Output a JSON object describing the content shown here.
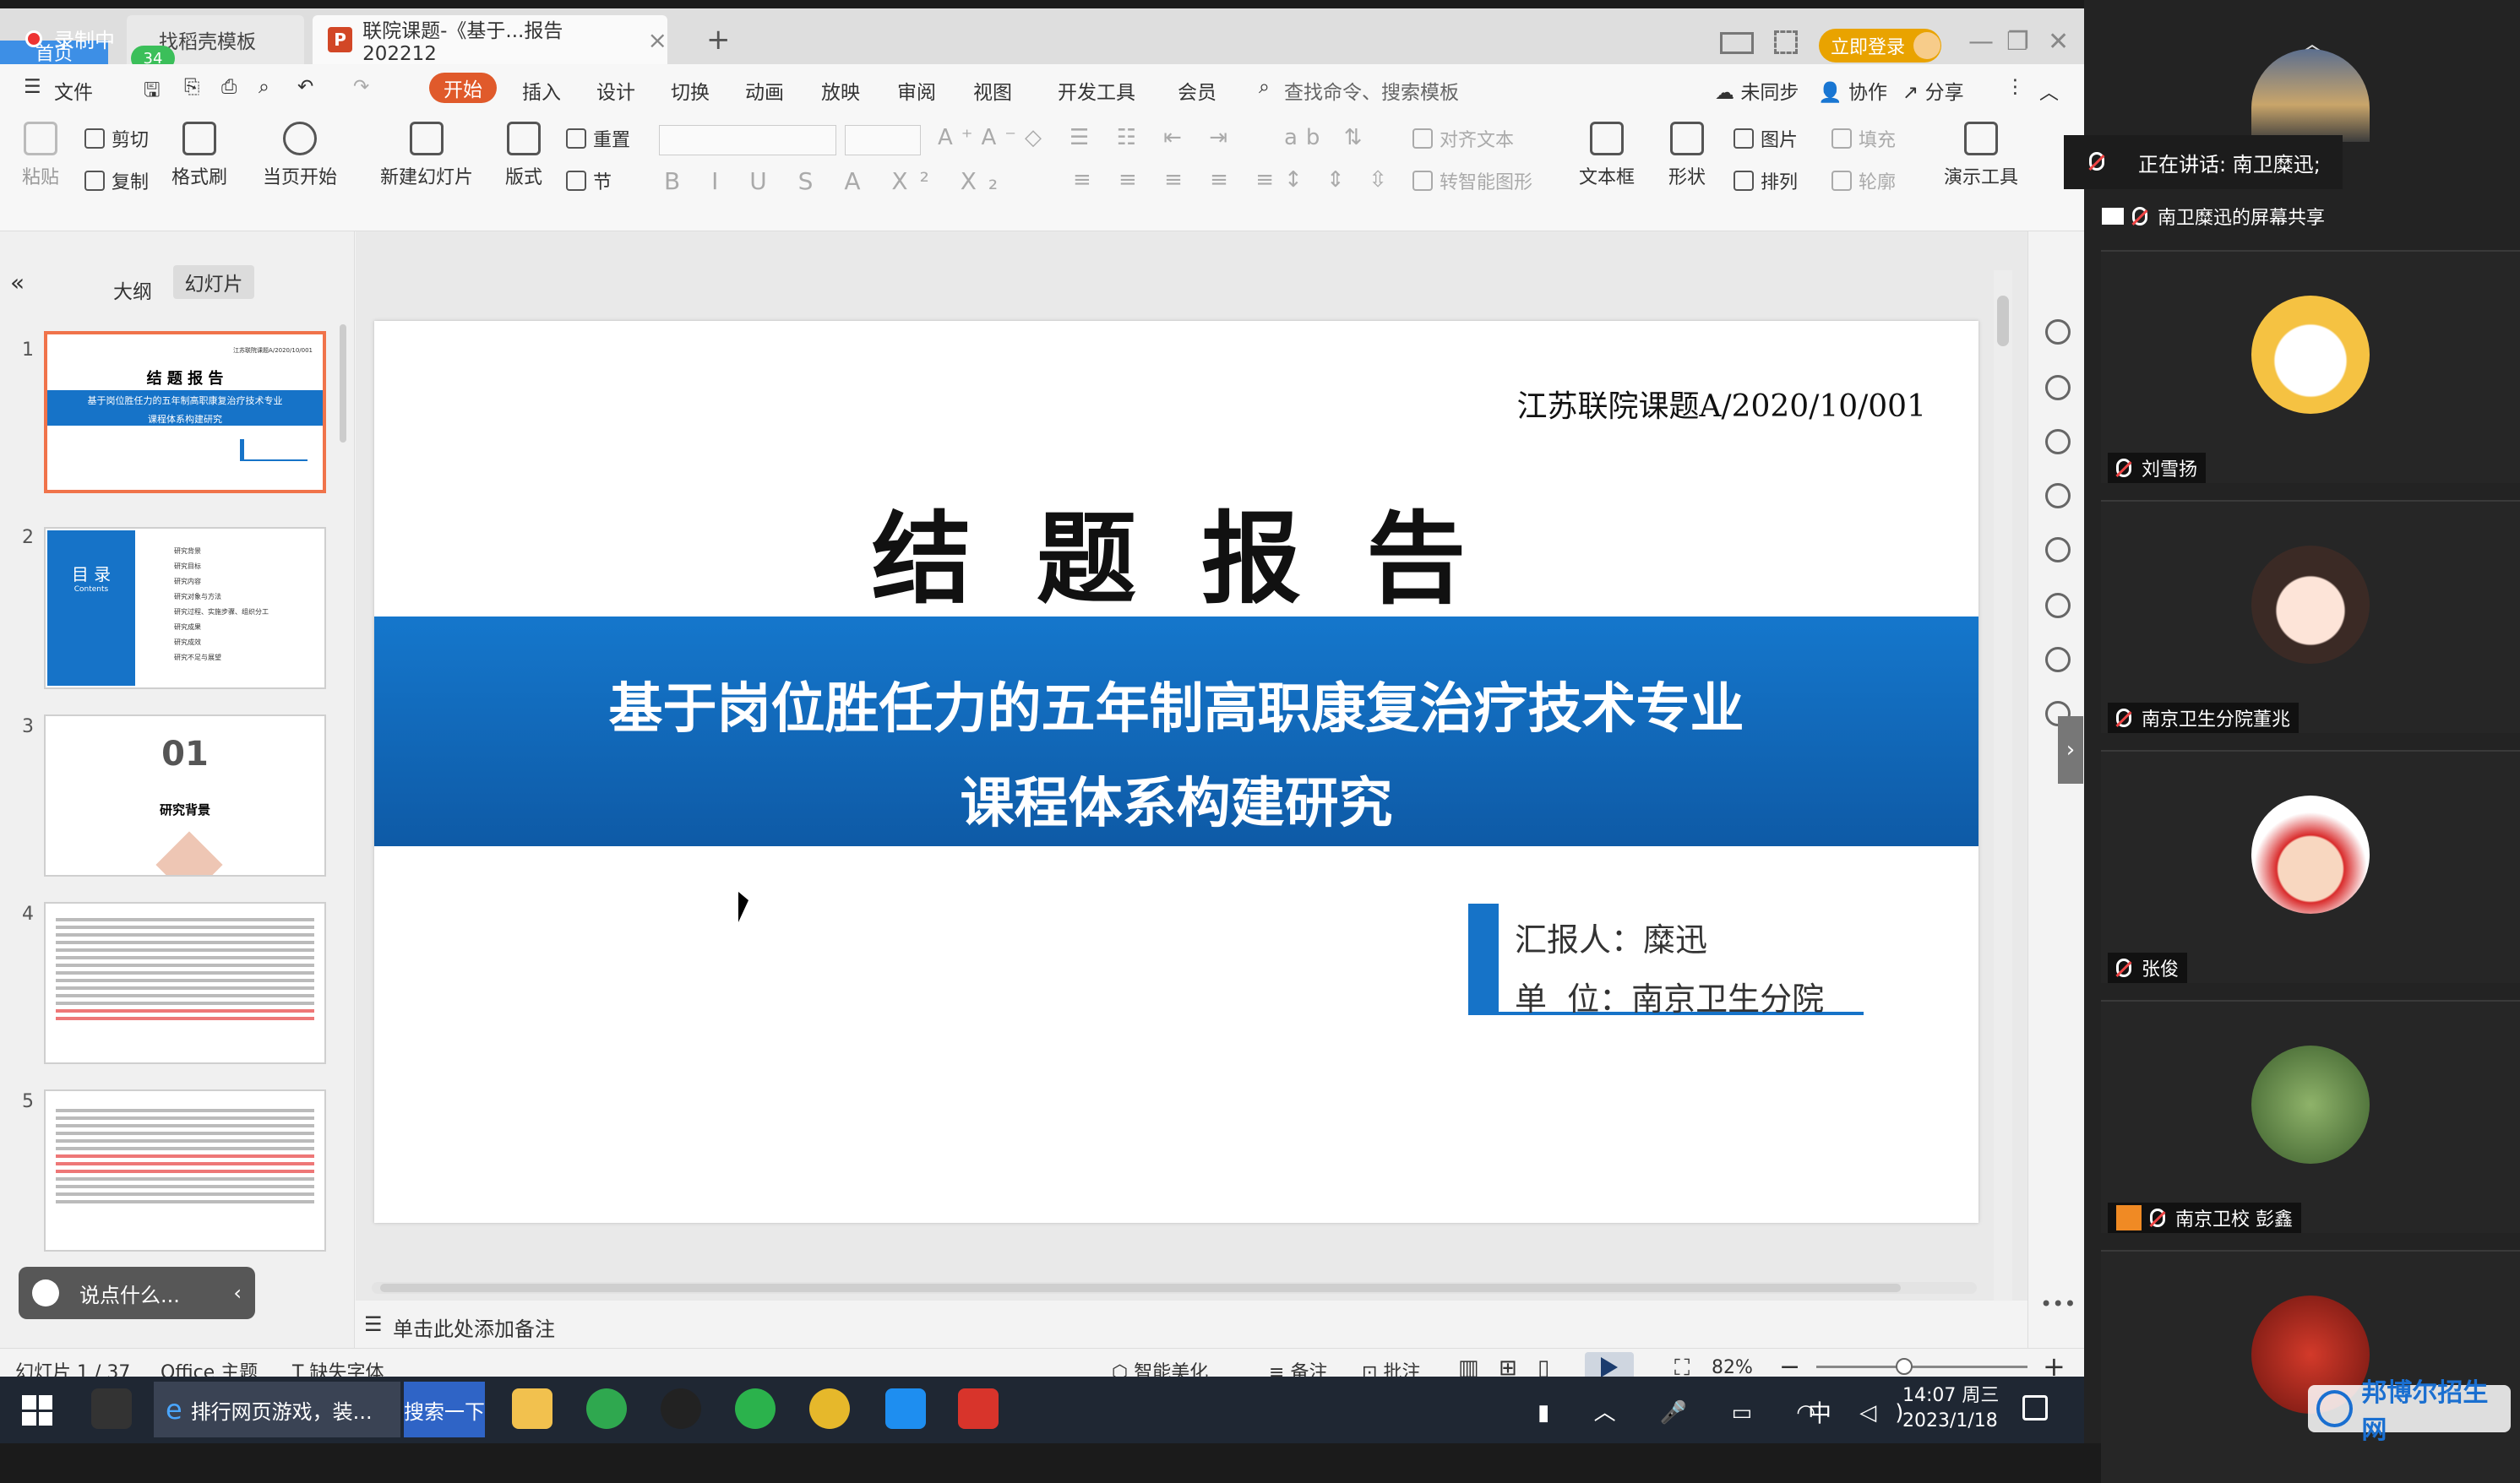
{
  "recording": {
    "label": "录制中",
    "badge": "34"
  },
  "tabs": {
    "home": "首页",
    "templates": "找稻壳模板",
    "document": "联院课题-《基于...报告202212",
    "add": "+"
  },
  "window": {
    "login": "立即登录"
  },
  "menu": {
    "file": "文件",
    "items": [
      "开始",
      "插入",
      "设计",
      "切换",
      "动画",
      "放映",
      "审阅",
      "视图",
      "开发工具",
      "会员"
    ],
    "search": "查找命令、搜索模板",
    "unsynced": "未同步",
    "collab": "协作",
    "share": "分享"
  },
  "ribbon": {
    "paste": "粘贴",
    "cut": "剪切",
    "copy": "复制",
    "format_painter": "格式刷",
    "from_current": "当页开始",
    "new_slide": "新建幻灯片",
    "layout": "版式",
    "reset": "重置",
    "section": "节",
    "align_text": "对齐文本",
    "convert_smart": "转智能图形",
    "textbox": "文本框",
    "shape": "形状",
    "picture": "图片",
    "arrange": "排列",
    "fill": "填充",
    "outline": "轮廓",
    "present_tools": "演示工具"
  },
  "leftpanel": {
    "outline_tab": "大纲",
    "slides_tab": "幻灯片",
    "collapse": "«",
    "thumbs": [
      {
        "num": "1",
        "title": "结 题 报 告",
        "subtitle": "基于岗位胜任力的五年制高职康复治疗技术专业",
        "subtitle2": "课程体系构建研究",
        "code": "江苏联院课题A/2020/10/001"
      },
      {
        "num": "2",
        "title": "目 录",
        "sub": "Contents",
        "items": [
          "研究背景",
          "研究目标",
          "研究内容",
          "研究对象与方法",
          "研究过程、实施步骤、组织分工",
          "研究成果",
          "研究成效",
          "研究不足与展望"
        ]
      },
      {
        "num": "3",
        "big": "01",
        "label": "研究背景"
      },
      {
        "num": "4"
      },
      {
        "num": "5"
      }
    ]
  },
  "slide": {
    "code": "江苏联院课题A/2020/10/001",
    "title": "结 题 报 告",
    "subtitle_line1": "基于岗位胜任力的五年制高职康复治疗技术专业",
    "subtitle_line2": "课程体系构建研究",
    "reporter": "汇报人：糜迅",
    "unit": "单  位：南京卫生分院",
    "band_color": "#1673c8",
    "accent_color": "#1673c8"
  },
  "notes": {
    "placeholder": "单击此处添加备注"
  },
  "chat": {
    "placeholder": "说点什么..."
  },
  "status": {
    "slide": "幻灯片 1 / 37",
    "theme": "Office 主题",
    "missing_font": "缺失字体",
    "beautify": "智能美化",
    "notes": "备注",
    "comments": "批注",
    "zoom": "82%"
  },
  "taskbar": {
    "ie": "排行网页游戏，装...",
    "search": "搜索一下",
    "time": "14:07 周三",
    "date": "2023/1/18",
    "ime": "中"
  },
  "meeting": {
    "speaking": "正在讲话: 南卫糜迅;",
    "share_label": "南卫糜迅的屏幕共享",
    "participants": [
      {
        "name": "刘雪扬"
      },
      {
        "name": "南京卫生分院董兆"
      },
      {
        "name": "张俊"
      },
      {
        "name": "南京卫校 彭鑫"
      },
      {
        "name": ""
      }
    ]
  },
  "watermark": {
    "label": "邦博尔招生网"
  }
}
